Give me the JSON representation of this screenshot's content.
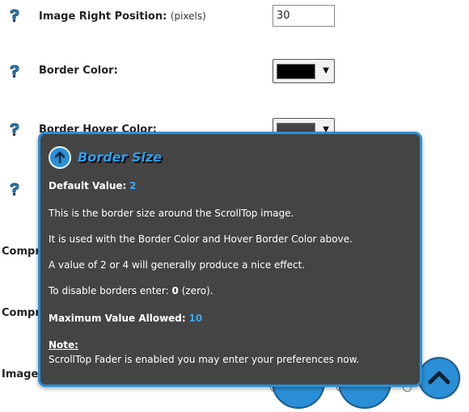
{
  "rows": [
    {
      "label": "Image Right Position:",
      "hint": "(pixels)",
      "value": "30"
    },
    {
      "label": "Border Color:",
      "swatch_color": "#000000"
    },
    {
      "label": "Border Hover Color:",
      "swatch_color": "#444444"
    }
  ],
  "side_labels": [
    "Compr",
    "Compr",
    "Image"
  ],
  "icons": {
    "help": "question-mark-icon",
    "tooltip_header": "arrow-up-circle-icon",
    "scroll_button": "chevron-up-icon"
  },
  "tooltip": {
    "title": "Border Size",
    "default_label": "Default Value:",
    "default_value": "2",
    "line1": "This is the border size around the ScrollTop image.",
    "line2": "It is used with the Border Color and Hover Border Color above.",
    "line3": "A value of 2 or 4 will generally produce a nice effect.",
    "line4_prefix": "To disable borders enter:",
    "line4_value": "0",
    "line4_suffix": "(zero).",
    "max_label": "Maximum Value Allowed:",
    "max_value": "10",
    "note_label": "Note:",
    "note_text": "ScrollTop Fader is enabled you may enter your preferences now."
  },
  "colors": {
    "accent": "#2a8fd6",
    "tooltip_bg": "#444444",
    "accent_text": "#3aa6f2"
  }
}
